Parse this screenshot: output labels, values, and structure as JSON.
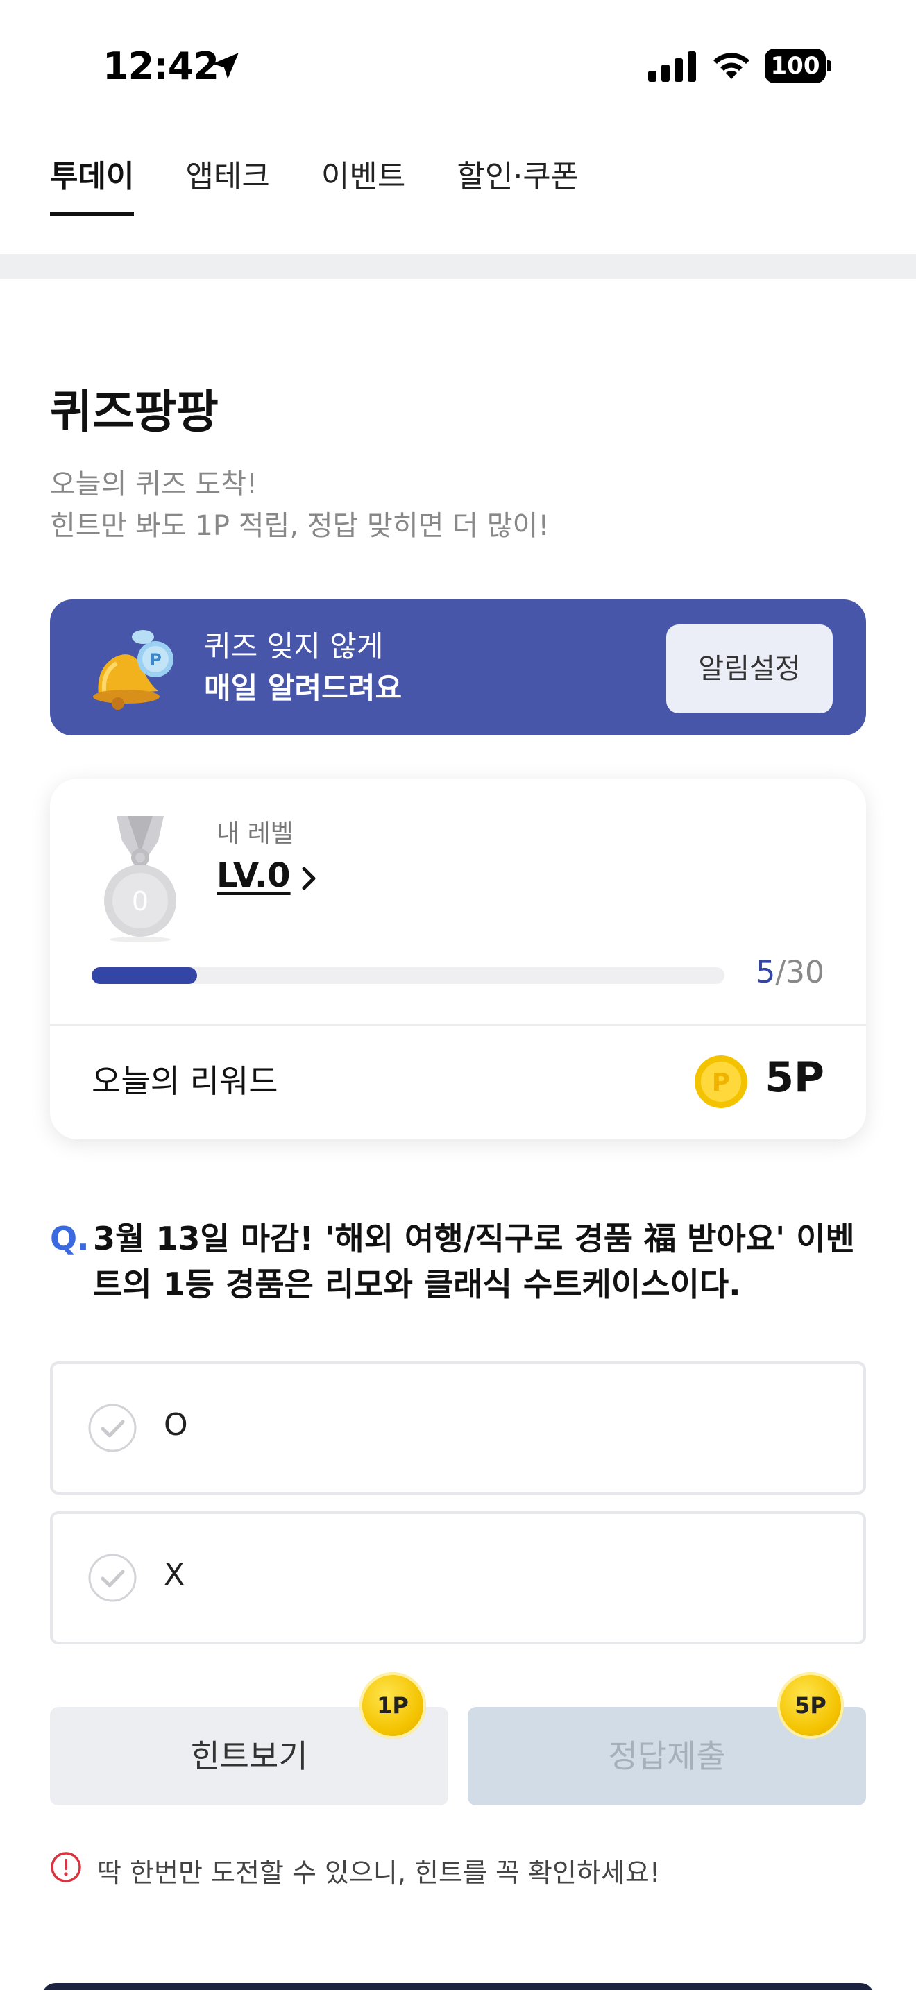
{
  "status_bar": {
    "time": "12:42",
    "battery": "100"
  },
  "tabs": [
    {
      "label": "투데이",
      "active": true
    },
    {
      "label": "앱테크",
      "active": false
    },
    {
      "label": "이벤트",
      "active": false
    },
    {
      "label": "할인·쿠폰",
      "active": false
    }
  ],
  "header": {
    "title": "퀴즈팡팡",
    "subtitle_line1": "오늘의 퀴즈 도착!",
    "subtitle_line2": "힌트만 봐도 1P 적립, 정답 맞히면 더 많이!"
  },
  "banner": {
    "line1": "퀴즈 잊지 않게",
    "line2": "매일 알려드려요",
    "button_label": "알림설정"
  },
  "level_card": {
    "level_label": "내 레벨",
    "level_value": "LV.0",
    "medal_number": "0",
    "progress_current": "5",
    "progress_total": "/30",
    "progress_fraction": 0.167,
    "reward_label": "오늘의 리워드",
    "reward_value": "5P"
  },
  "quiz": {
    "q_mark": "Q.",
    "question": "3월 13일 마감! '해외 여행/직구로 경품 福 받아요' 이벤트의 1등 경품은 리모와 클래식 수트케이스이다.",
    "options": [
      {
        "label": "O"
      },
      {
        "label": "X"
      }
    ]
  },
  "actions": {
    "hint_label": "힌트보기",
    "hint_badge": "1P",
    "submit_label": "정답제출",
    "submit_badge": "5P"
  },
  "notice": {
    "text": "딱 한번만 도전할 수 있으니, 힌트를 꼭 확인하세요!"
  },
  "colors": {
    "banner_bg": "#4756a8",
    "progress_fill": "#3346a6",
    "q_mark": "#3b6ae0",
    "warning": "#d9333f",
    "coin": "#f4c300"
  }
}
